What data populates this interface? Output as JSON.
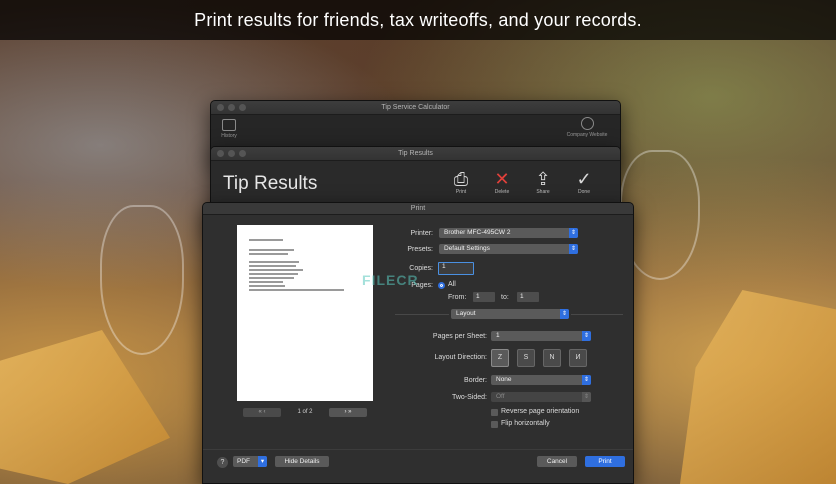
{
  "banner": {
    "text": "Print results for friends, tax writeoffs, and your records."
  },
  "window_main": {
    "title": "Tip Service Calculator",
    "history_label": "History",
    "company_label": "Company Website"
  },
  "window_results": {
    "title": "Tip Results",
    "heading": "Tip Results",
    "toolbar": {
      "print": "Print",
      "delete": "Delete",
      "share": "Share",
      "done": "Done"
    }
  },
  "print_dialog": {
    "title": "Print",
    "page_indicator": "1 of 2",
    "printer": {
      "label": "Printer:",
      "value": "Brother MFC-495CW 2"
    },
    "presets": {
      "label": "Presets:",
      "value": "Default Settings"
    },
    "copies": {
      "label": "Copies:",
      "value": "1"
    },
    "pages": {
      "label": "Pages:",
      "all": "All",
      "from_label": "From:",
      "from_value": "1",
      "to_label": "to:",
      "to_value": "1"
    },
    "section": "Layout",
    "pages_per_sheet": {
      "label": "Pages per Sheet:",
      "value": "1"
    },
    "layout_direction": {
      "label": "Layout Direction:"
    },
    "border": {
      "label": "Border:",
      "value": "None"
    },
    "two_sided": {
      "label": "Two-Sided:",
      "value": "Off"
    },
    "reverse_orientation": "Reverse page orientation",
    "flip_horizontally": "Flip horizontally",
    "help": "?",
    "pdf": "PDF",
    "hide_details": "Hide Details",
    "cancel": "Cancel",
    "print": "Print"
  },
  "watermark": "FILECR"
}
